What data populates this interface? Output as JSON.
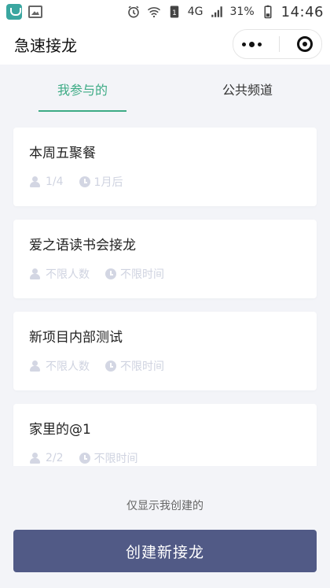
{
  "status_bar": {
    "battery": "31%",
    "network": "4G",
    "time": "14:46"
  },
  "nav": {
    "title": "急速接龙"
  },
  "tabs": [
    {
      "label": "我参与的",
      "active": true
    },
    {
      "label": "公共频道",
      "active": false
    }
  ],
  "cards": [
    {
      "title": "本周五聚餐",
      "people": "1/4",
      "time": "1月后"
    },
    {
      "title": "爱之语读书会接龙",
      "people": "不限人数",
      "time": "不限时间"
    },
    {
      "title": "新项目内部测试",
      "people": "不限人数",
      "time": "不限时间"
    },
    {
      "title": "家里的@1",
      "people": "2/2",
      "time": "不限时间"
    }
  ],
  "footer": {
    "filter_text": "仅显示我创建的",
    "create_button": "创建新接龙"
  },
  "colors": {
    "accent": "#3dab85",
    "button": "#515a86",
    "background": "#f3f4f8"
  }
}
